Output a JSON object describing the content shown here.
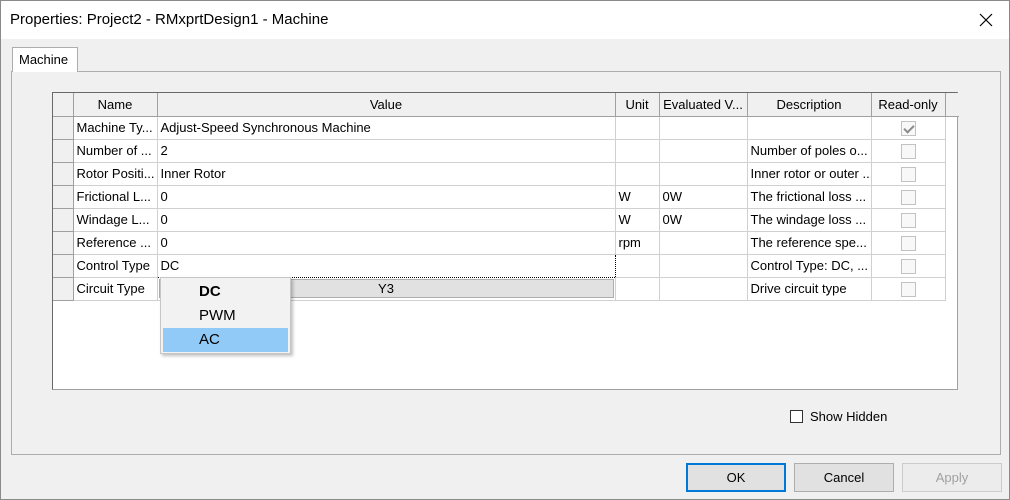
{
  "window": {
    "title": "Properties: Project2 - RMxprtDesign1 - Machine",
    "close_glyph": "close-icon"
  },
  "tabs": [
    {
      "label": "Machine",
      "active": true
    }
  ],
  "grid": {
    "columns": [
      "Name",
      "Value",
      "Unit",
      "Evaluated V...",
      "Description",
      "Read-only"
    ],
    "rows": [
      {
        "name": "Machine Ty...",
        "value": "Adjust-Speed Synchronous Machine",
        "unit": "",
        "evaluated": "",
        "description": "",
        "readonly": true
      },
      {
        "name": "Number of ...",
        "value": "2",
        "unit": "",
        "evaluated": "",
        "description": "Number of poles o...",
        "readonly": false
      },
      {
        "name": "Rotor Positi...",
        "value": "Inner Rotor",
        "unit": "",
        "evaluated": "",
        "description": "Inner rotor or outer ...",
        "readonly": false
      },
      {
        "name": "Frictional L...",
        "value": "0",
        "unit": "W",
        "evaluated": "0W",
        "description": "The frictional loss ...",
        "readonly": false
      },
      {
        "name": "Windage L...",
        "value": "0",
        "unit": "W",
        "evaluated": "0W",
        "description": "The windage loss ...",
        "readonly": false
      },
      {
        "name": "Reference ...",
        "value": "0",
        "unit": "rpm",
        "evaluated": "",
        "description": "The reference spe...",
        "readonly": false
      },
      {
        "name": "Control Type",
        "value": "DC",
        "unit": "",
        "evaluated": "",
        "description": "Control Type: DC, ...",
        "readonly": false
      },
      {
        "name": "Circuit Type",
        "value": "Y3",
        "unit": "",
        "evaluated": "",
        "description": "Drive circuit type",
        "readonly": false
      }
    ]
  },
  "dropdown": {
    "options": [
      {
        "label": "DC",
        "bold": true,
        "selected": false
      },
      {
        "label": "PWM",
        "bold": false,
        "selected": false
      },
      {
        "label": "AC",
        "bold": false,
        "selected": true
      }
    ],
    "highlight_color": "#91c9f7"
  },
  "show_hidden": {
    "label": "Show Hidden",
    "checked": false
  },
  "buttons": {
    "ok": "OK",
    "cancel": "Cancel",
    "apply": "Apply"
  },
  "colors": {
    "accent": "#0078d7",
    "dialog_bg": "#f0f0f0"
  }
}
